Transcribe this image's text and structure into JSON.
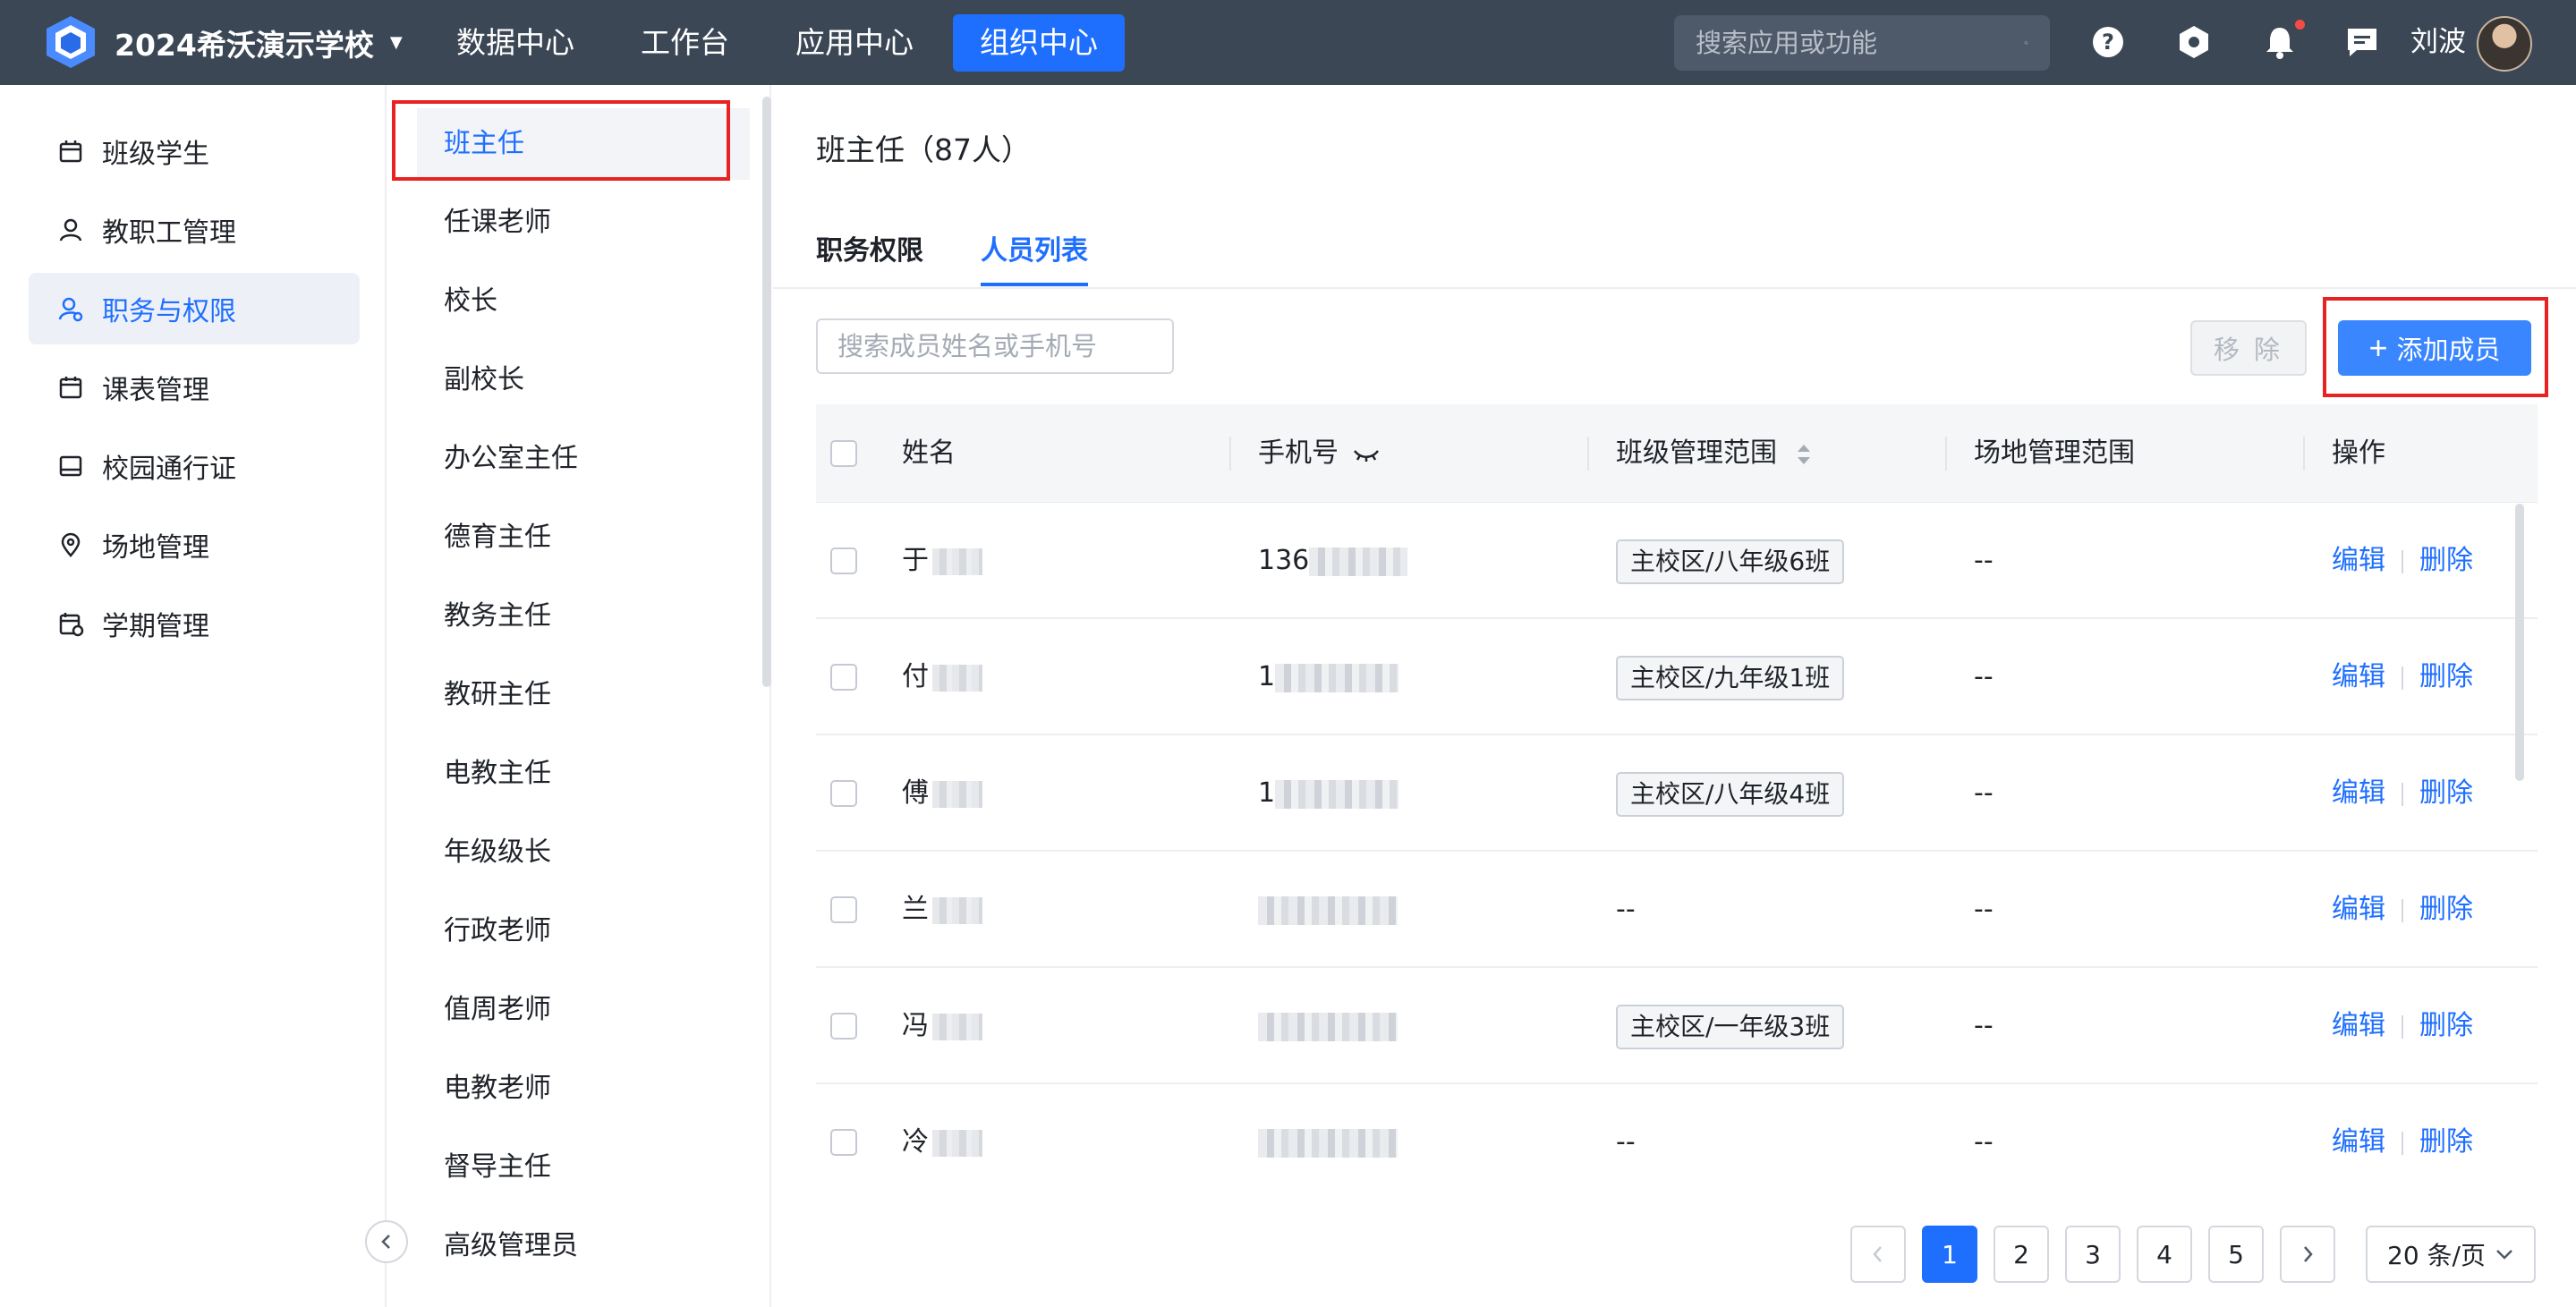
{
  "header": {
    "school_name": "2024希沃演示学校",
    "nav": [
      "数据中心",
      "工作台",
      "应用中心",
      "组织中心"
    ],
    "active_nav": "组织中心",
    "search_placeholder": "搜索应用或功能",
    "user_name": "刘波"
  },
  "sidebar": {
    "items": [
      {
        "label": "班级学生",
        "icon": "class-icon"
      },
      {
        "label": "教职工管理",
        "icon": "person-icon"
      },
      {
        "label": "职务与权限",
        "icon": "role-icon",
        "active": true
      },
      {
        "label": "课表管理",
        "icon": "calendar-icon"
      },
      {
        "label": "校园通行证",
        "icon": "card-icon"
      },
      {
        "label": "场地管理",
        "icon": "location-icon"
      },
      {
        "label": "学期管理",
        "icon": "term-icon"
      }
    ]
  },
  "roles": [
    "班主任",
    "任课老师",
    "校长",
    "副校长",
    "办公室主任",
    "德育主任",
    "教务主任",
    "教研主任",
    "电教主任",
    "年级级长",
    "行政老师",
    "值周老师",
    "电教老师",
    "督导主任",
    "高级管理员"
  ],
  "main": {
    "title": "班主任（87人）",
    "tabs": [
      "职务权限",
      "人员列表"
    ],
    "active_tab": "人员列表",
    "search_placeholder": "搜索成员姓名或手机号",
    "remove_label": "移 除",
    "add_label": "添加成员",
    "columns": {
      "name": "姓名",
      "phone": "手机号",
      "class_scope": "班级管理范围",
      "venue_scope": "场地管理范围",
      "actions": "操作"
    },
    "rows": [
      {
        "name": "于",
        "phone": "136",
        "class_scope": "主校区/八年级6班",
        "venue_scope": "--"
      },
      {
        "name": "付",
        "phone": "1",
        "class_scope": "主校区/九年级1班",
        "venue_scope": "--"
      },
      {
        "name": "傅",
        "phone": "1",
        "class_scope": "主校区/八年级4班",
        "venue_scope": "--"
      },
      {
        "name": "兰",
        "phone": "",
        "class_scope": "--",
        "venue_scope": "--"
      },
      {
        "name": "冯",
        "phone": "",
        "class_scope": "主校区/一年级3班",
        "venue_scope": "--"
      },
      {
        "name": "冷",
        "phone": "",
        "class_scope": "--",
        "venue_scope": "--"
      }
    ],
    "edit_label": "编辑",
    "delete_label": "删除",
    "pagination": {
      "pages": [
        "1",
        "2",
        "3",
        "4",
        "5"
      ],
      "current": "1",
      "page_size": "20 条/页"
    }
  },
  "colors": {
    "accent": "#1f6fff",
    "topbar": "#3c4756",
    "highlight": "#e82222"
  }
}
